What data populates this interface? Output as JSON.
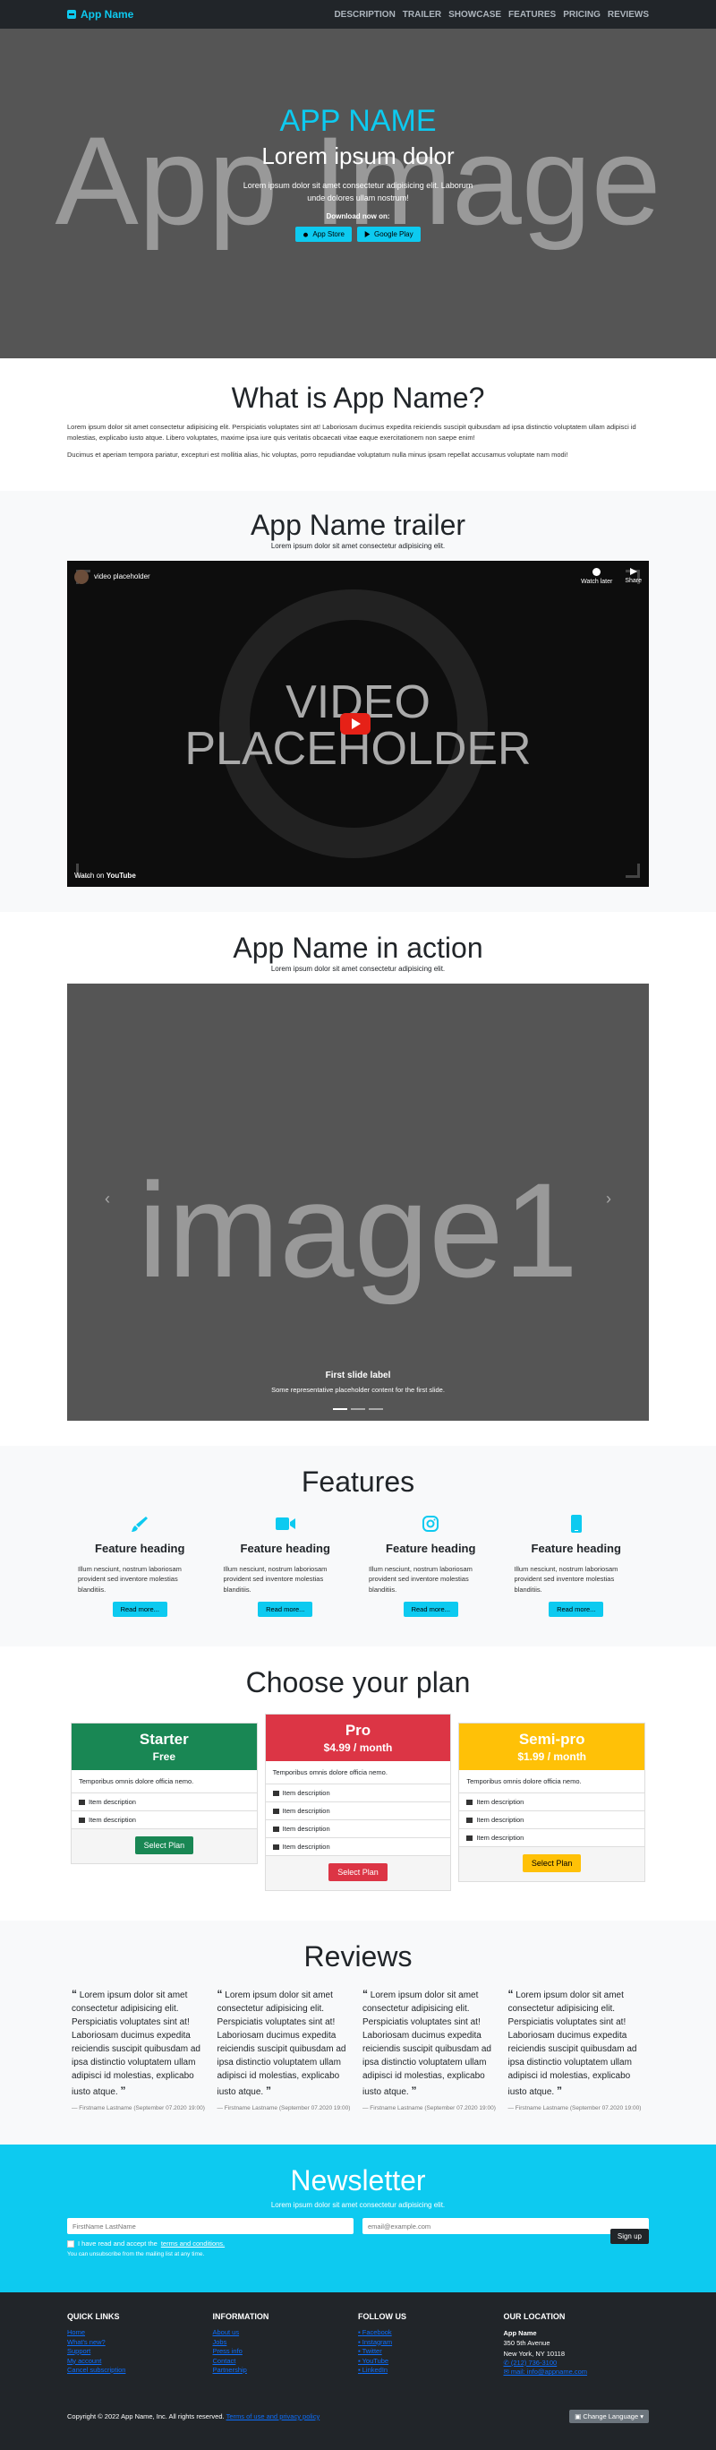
{
  "nav": {
    "brand": "App Name",
    "links": [
      "DESCRIPTION",
      "TRAILER",
      "SHOWCASE",
      "FEATURES",
      "PRICING",
      "REVIEWS"
    ]
  },
  "hero": {
    "bg_text": "App Image",
    "title": "APP NAME",
    "subtitle": "Lorem ipsum dolor",
    "text": "Lorem ipsum dolor sit amet consectetur adipisicing elit. Laborum unde dolores ullam nostrum!",
    "download_label": "Download now on:",
    "app_store": "App Store",
    "google_play": "Google Play"
  },
  "what": {
    "title": "What is App Name?",
    "p1": "Lorem ipsum dolor sit amet consectetur adipisicing elit. Perspiciatis voluptates sint at! Laboriosam ducimus expedita reiciendis suscipit quibusdam ad ipsa distinctio voluptatem ullam adipisci id molestias, explicabo iusto atque. Libero voluptates, maxime ipsa iure quis veritatis obcaecati vitae eaque exercitationem non saepe enim!",
    "p2": "Ducimus et aperiam tempora pariatur, excepturi est mollitia alias, hic voluptas, porro repudiandae voluptatum nulla minus ipsam repellat accusamus voluptate nam modi!"
  },
  "trailer": {
    "title": "App Name trailer",
    "lead": "Lorem ipsum dolor sit amet consectetur adipisicing elit.",
    "video_title": "video placeholder",
    "watch_later": "Watch later",
    "share": "Share",
    "placeholder_line1": "VIDEO",
    "placeholder_line2": "PLACEHOLDER",
    "watch_on": "Watch on",
    "youtube": "YouTube"
  },
  "showcase": {
    "title": "App Name in action",
    "lead": "Lorem ipsum dolor sit amet consectetur adipisicing elit.",
    "image_text": "image1",
    "caption_title": "First slide label",
    "caption_text": "Some representative placeholder content for the first slide.",
    "slides": 3,
    "active_slide": 1
  },
  "features": {
    "title": "Features",
    "items": [
      {
        "icon": "brush-icon",
        "heading": "Feature heading",
        "text": "Illum nesciunt, nostrum laboriosam provident sed inventore molestias blanditiis.",
        "button": "Read more..."
      },
      {
        "icon": "video-camera-icon",
        "heading": "Feature heading",
        "text": "Illum nesciunt, nostrum laboriosam provident sed inventore molestias blanditiis.",
        "button": "Read more..."
      },
      {
        "icon": "instagram-icon",
        "heading": "Feature heading",
        "text": "Illum nesciunt, nostrum laboriosam provident sed inventore molestias blanditiis.",
        "button": "Read more..."
      },
      {
        "icon": "phone-icon",
        "heading": "Feature heading",
        "text": "Illum nesciunt, nostrum laboriosam provident sed inventore molestias blanditiis.",
        "button": "Read more..."
      }
    ],
    "accent": "#0dcaf0"
  },
  "pricing": {
    "title": "Choose your plan",
    "plans": [
      {
        "name": "Starter",
        "price": "Free",
        "color": "#198754",
        "desc": "Temporibus omnis dolore officia nemo.",
        "items": [
          "Item description",
          "Item description"
        ],
        "button": "Select Plan"
      },
      {
        "name": "Pro",
        "price": "$4.99 / month",
        "color": "#dc3545",
        "desc": "Temporibus omnis dolore officia nemo.",
        "items": [
          "Item description",
          "Item description",
          "Item description",
          "Item description"
        ],
        "button": "Select Plan"
      },
      {
        "name": "Semi-pro",
        "price": "$1.99 / month",
        "color": "#ffc107",
        "desc": "Temporibus omnis dolore officia nemo.",
        "items": [
          "Item description",
          "Item description",
          "Item description"
        ],
        "button": "Select Plan"
      }
    ]
  },
  "reviews": {
    "title": "Reviews",
    "items": [
      {
        "text": "Lorem ipsum dolor sit amet consectetur adipisicing elit. Perspiciatis voluptates sint at! Laboriosam ducimus expedita reiciendis suscipit quibusdam ad ipsa distinctio voluptatem ullam adipisci id molestias, explicabo iusto atque.",
        "author": "— Firstname Lastname (September 07.2020 19:00)"
      },
      {
        "text": "Lorem ipsum dolor sit amet consectetur adipisicing elit. Perspiciatis voluptates sint at! Laboriosam ducimus expedita reiciendis suscipit quibusdam ad ipsa distinctio voluptatem ullam adipisci id molestias, explicabo iusto atque.",
        "author": "— Firstname Lastname (September 07.2020 19:00)"
      },
      {
        "text": "Lorem ipsum dolor sit amet consectetur adipisicing elit. Perspiciatis voluptates sint at! Laboriosam ducimus expedita reiciendis suscipit quibusdam ad ipsa distinctio voluptatem ullam adipisci id molestias, explicabo iusto atque.",
        "author": "— Firstname Lastname (September 07.2020 19:00)"
      },
      {
        "text": "Lorem ipsum dolor sit amet consectetur adipisicing elit. Perspiciatis voluptates sint at! Laboriosam ducimus expedita reiciendis suscipit quibusdam ad ipsa distinctio voluptatem ullam adipisci id molestias, explicabo iusto atque.",
        "author": "— Firstname Lastname (September 07.2020 19:00)"
      }
    ]
  },
  "newsletter": {
    "title": "Newsletter",
    "lead": "Lorem ipsum dolor sit amet consectetur adipisicing elit.",
    "name_placeholder": "FirstName LastName",
    "email_placeholder": "email@example.com",
    "consent_prefix": "I have read and accept the",
    "consent_link": "terms and conditions.",
    "unsubscribe_note": "You can unsubscribe from the mailing list at any time.",
    "signup": "Sign up"
  },
  "footer": {
    "quick_links": {
      "title": "QUICK LINKS",
      "links": [
        "Home",
        "What's new?",
        "Support",
        "My account",
        "Cancel subscription"
      ]
    },
    "information": {
      "title": "INFORMATION",
      "links": [
        "About us",
        "Jobs",
        "Press info",
        "Contact",
        "Partnership"
      ]
    },
    "follow": {
      "title": "FOLLOW US",
      "links": [
        {
          "icon": "facebook-icon",
          "label": "Facebook"
        },
        {
          "icon": "instagram-icon",
          "label": "Instagram"
        },
        {
          "icon": "twitter-icon",
          "label": "Twitter"
        },
        {
          "icon": "youtube-icon",
          "label": "YouTube"
        },
        {
          "icon": "linkedin-icon",
          "label": "LinkedIn"
        }
      ]
    },
    "location": {
      "title": "OUR LOCATION",
      "name": "App Name",
      "street": "350 5th Avenue",
      "city": "New York, NY 10118",
      "phone": "(212) 736-3100",
      "email": "mail: info@appname.com"
    },
    "copyright": "Copyright © 2022 App Name, Inc. All rights reserved.",
    "terms_link": "Terms of use and privacy policy",
    "language": "Change Language"
  }
}
